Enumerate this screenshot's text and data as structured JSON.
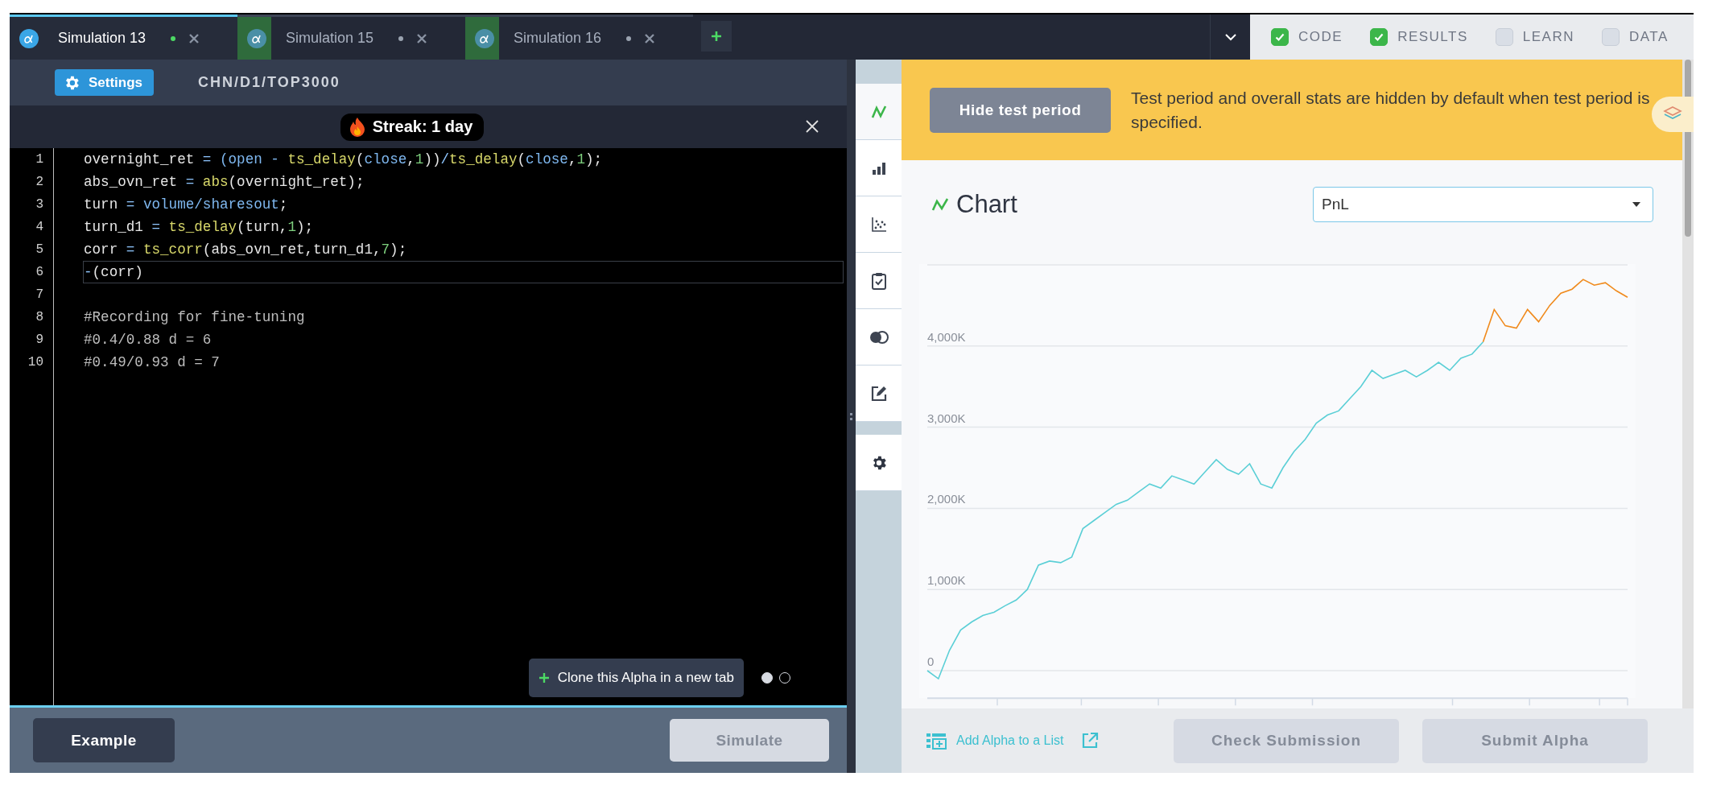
{
  "tabs": [
    {
      "title": "Simulation 13",
      "selected": true,
      "modified": true,
      "highlighted": false
    },
    {
      "title": "Simulation 15",
      "selected": false,
      "modified": true,
      "highlighted": true
    },
    {
      "title": "Simulation 16",
      "selected": false,
      "modified": true,
      "highlighted": true
    }
  ],
  "panels": [
    {
      "label": "CODE",
      "checked": true
    },
    {
      "label": "RESULTS",
      "checked": true
    },
    {
      "label": "LEARN",
      "checked": false
    },
    {
      "label": "DATA",
      "checked": false
    }
  ],
  "settings": {
    "button": "Settings",
    "universe": "CHN/D1/TOP3000"
  },
  "streak": {
    "text": "Streak: **1** day"
  },
  "editor": {
    "lines": [
      {
        "number": "1",
        "current": false,
        "tokens": [
          {
            "text": "overnight_ret",
            "kind": "plain"
          },
          {
            "text": " = ",
            "kind": "op"
          },
          {
            "text": "(open - ",
            "kind": "field"
          },
          {
            "text": "ts_delay",
            "kind": "func"
          },
          {
            "text": "(",
            "kind": "plain"
          },
          {
            "text": "close",
            "kind": "field"
          },
          {
            "text": ",",
            "kind": "plain"
          },
          {
            "text": "1",
            "kind": "num"
          },
          {
            "text": "))",
            "kind": "plain"
          },
          {
            "text": "/",
            "kind": "op"
          },
          {
            "text": "ts_delay",
            "kind": "func"
          },
          {
            "text": "(",
            "kind": "plain"
          },
          {
            "text": "close",
            "kind": "field"
          },
          {
            "text": ",",
            "kind": "plain"
          },
          {
            "text": "1",
            "kind": "num"
          },
          {
            "text": ");",
            "kind": "plain"
          }
        ]
      },
      {
        "number": "2",
        "current": false,
        "tokens": [
          {
            "text": "abs_ovn_ret",
            "kind": "plain"
          },
          {
            "text": " = ",
            "kind": "op"
          },
          {
            "text": "abs",
            "kind": "func"
          },
          {
            "text": "(overnight_ret);",
            "kind": "plain"
          }
        ]
      },
      {
        "number": "3",
        "current": false,
        "tokens": [
          {
            "text": "turn",
            "kind": "plain"
          },
          {
            "text": " = ",
            "kind": "op"
          },
          {
            "text": "volume/sharesout",
            "kind": "field"
          },
          {
            "text": ";",
            "kind": "plain"
          }
        ]
      },
      {
        "number": "4",
        "current": false,
        "tokens": [
          {
            "text": "turn_d1",
            "kind": "plain"
          },
          {
            "text": " = ",
            "kind": "op"
          },
          {
            "text": "ts_delay",
            "kind": "func"
          },
          {
            "text": "(turn,",
            "kind": "plain"
          },
          {
            "text": "1",
            "kind": "num"
          },
          {
            "text": ");",
            "kind": "plain"
          }
        ]
      },
      {
        "number": "5",
        "current": false,
        "tokens": [
          {
            "text": "corr",
            "kind": "plain"
          },
          {
            "text": " = ",
            "kind": "op"
          },
          {
            "text": "ts_corr",
            "kind": "func"
          },
          {
            "text": "(abs_ovn_ret,turn_d1,",
            "kind": "plain"
          },
          {
            "text": "7",
            "kind": "num"
          },
          {
            "text": ");",
            "kind": "plain"
          }
        ]
      },
      {
        "number": "6",
        "current": true,
        "tokens": [
          {
            "text": "-",
            "kind": "op"
          },
          {
            "text": "(corr)",
            "kind": "plain"
          }
        ]
      },
      {
        "number": "7",
        "current": false
      },
      {
        "number": "8",
        "current": false,
        "tokens": [
          {
            "text": "#Recording for fine-tuning",
            "kind": "comment"
          }
        ]
      },
      {
        "number": "9",
        "current": false,
        "tokens": [
          {
            "text": "#0.4/0.88 d = 6",
            "kind": "comment"
          }
        ]
      },
      {
        "number": "10",
        "current": false,
        "tokens": [
          {
            "text": "#0.49/0.93 d = 7",
            "kind": "comment"
          }
        ]
      }
    ]
  },
  "clone": {
    "label": "Clone this Alpha in a new tab",
    "pages": [
      {
        "selected": true
      },
      {
        "selected": false
      }
    ]
  },
  "actions": {
    "example": {
      "label": "Example",
      "disabled": false
    },
    "simulate": {
      "label": "Simulate",
      "disabled": true
    }
  },
  "rail": {
    "items": [
      {
        "selected": true
      },
      {
        "selected": false
      },
      {
        "selected": false
      },
      {
        "selected": false
      },
      {
        "selected": false
      },
      {
        "selected": false
      }
    ],
    "settings": {
      "selected": false
    }
  },
  "banner": {
    "button": "Hide test period",
    "message": "Test period and overall stats are hidden by default when test period is specified."
  },
  "chart": {
    "title": "Chart",
    "select": "PnL",
    "chart_data": {
      "type": "line",
      "grid": true,
      "ylim": [
        -340,
        5000
      ],
      "yticks": [
        {
          "value": 0,
          "label": "0"
        },
        {
          "value": 1000,
          "label": "1,000K"
        },
        {
          "value": 2000,
          "label": "2,000K"
        },
        {
          "value": 3000,
          "label": "3,000K"
        },
        {
          "value": 4000,
          "label": "4,000K"
        }
      ],
      "series": [
        {
          "color": "#5bcfd6",
          "values": [
            0,
            -100,
            250,
            500,
            600,
            680,
            720,
            800,
            870,
            1000,
            1300,
            1350,
            1330,
            1400,
            1750,
            1850,
            1950,
            2050,
            2100,
            2200,
            2300,
            2250,
            2400,
            2350,
            2300,
            2450,
            2600,
            2480,
            2420,
            2550,
            2300,
            2250,
            2500,
            2700,
            2850,
            3050,
            3150,
            3200,
            3350,
            3500,
            3700,
            3600,
            3650,
            3700,
            3620,
            3700,
            3800,
            3700,
            3850,
            3900,
            4050,
            null,
            null,
            null,
            null,
            null,
            null,
            null,
            null,
            null,
            null,
            null,
            null,
            null
          ]
        },
        {
          "color": "#f08a1c",
          "values": [
            null,
            null,
            null,
            null,
            null,
            null,
            null,
            null,
            null,
            null,
            null,
            null,
            null,
            null,
            null,
            null,
            null,
            null,
            null,
            null,
            null,
            null,
            null,
            null,
            null,
            null,
            null,
            null,
            null,
            null,
            null,
            null,
            null,
            null,
            null,
            null,
            null,
            null,
            null,
            null,
            null,
            null,
            null,
            null,
            null,
            null,
            null,
            null,
            null,
            null,
            4050,
            4450,
            4250,
            4220,
            4450,
            4300,
            4500,
            4650,
            4700,
            4820,
            4750,
            4780,
            4680,
            4600
          ]
        }
      ]
    }
  },
  "footer": {
    "link": "Add Alpha to a List",
    "check": {
      "label": "Check Submission",
      "disabled": true
    },
    "submit": {
      "label": "Submit Alpha",
      "disabled": true
    }
  }
}
